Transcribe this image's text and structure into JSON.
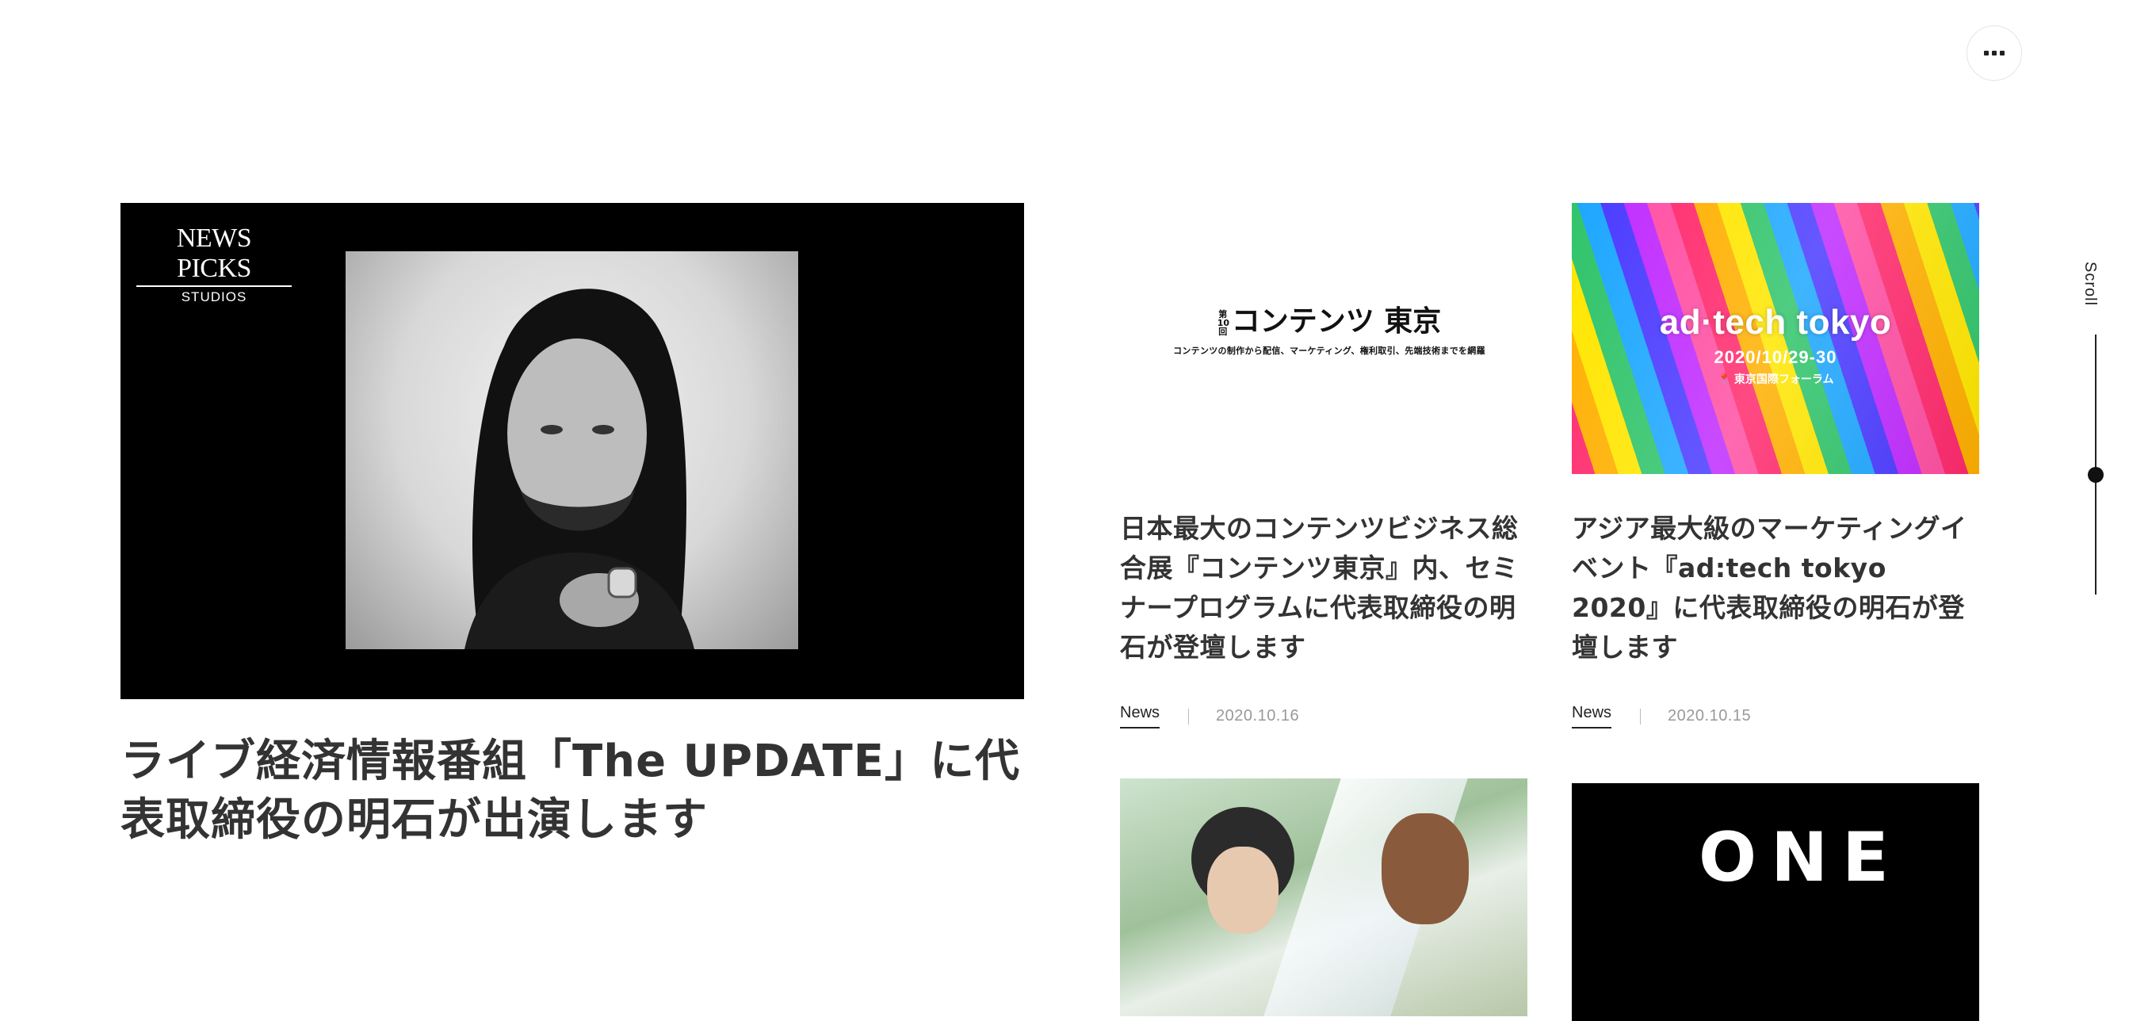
{
  "header": {
    "menu_icon": "more-dots-icon"
  },
  "featured": {
    "logo_line1": "NEWS PICKS",
    "logo_line2": "STUDIOS",
    "title": "ライブ経済情報番組「The UPDATE」に代表取締役の明石が出演します"
  },
  "cards": [
    {
      "logo_main": "コンテンツ 東京",
      "logo_badge": "第10回",
      "logo_sub": "コンテンツの制作から配信、マーケティング、権利取引、先端技術までを網羅",
      "title": "日本最大のコンテンツビジネス総合展『コンテンツ東京』内、セミナープログラムに代表取締役の明石が登壇します",
      "category": "News",
      "date": "2020.10.16"
    },
    {
      "logo_main": "ad·tech tokyo",
      "logo_date": "2020/10/29-30",
      "logo_venue": "📍 東京国際フォーラム",
      "title": "アジア最大級のマーケティングイベント『ad:tech tokyo 2020』に代表取締役の明石が登壇します",
      "category": "News",
      "date": "2020.10.15"
    },
    {
      "title": ""
    },
    {
      "logo_main": "ONE"
    }
  ],
  "scroll": {
    "label": "Scroll",
    "progress": 0.54
  }
}
